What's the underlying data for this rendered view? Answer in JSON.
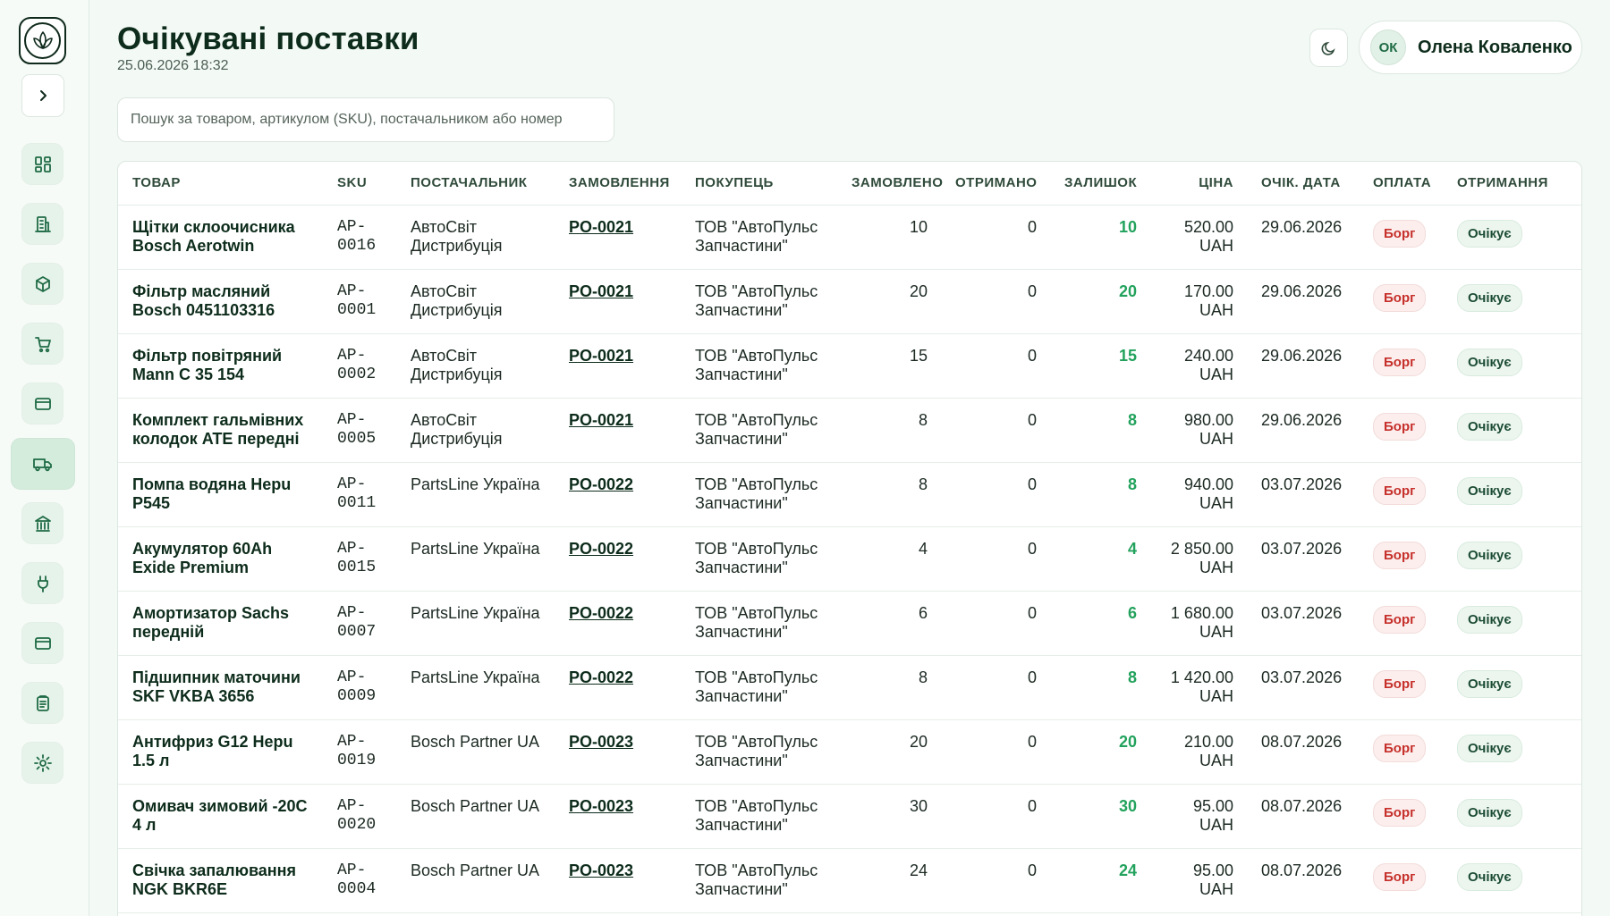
{
  "header": {
    "title": "Очікувані поставки",
    "timestamp": "25.06.2026 18:32"
  },
  "user": {
    "initials": "ОК",
    "name": "Олена Коваленко"
  },
  "search": {
    "placeholder": "Пошук за товаром, артикулом (SKU), постачальником або номер"
  },
  "sidebar": {
    "items": [
      {
        "icon": "dashboard-icon"
      },
      {
        "icon": "building-icon"
      },
      {
        "icon": "box-icon"
      },
      {
        "icon": "cart-icon"
      },
      {
        "icon": "card-icon"
      },
      {
        "icon": "truck-icon",
        "active": true
      },
      {
        "icon": "bank-icon"
      },
      {
        "icon": "plug-icon"
      },
      {
        "icon": "card-icon"
      },
      {
        "icon": "clipboard-icon"
      },
      {
        "icon": "gear-icon"
      }
    ]
  },
  "table": {
    "columns": [
      "ТОВАР",
      "SKU",
      "ПОСТАЧАЛЬНИК",
      "ЗАМОВЛЕННЯ",
      "ПОКУПЕЦЬ",
      "ЗАМОВЛЕНО",
      "ОТРИМАНО",
      "ЗАЛИШОК",
      "ЦІНА",
      "ОЧІК. ДАТА",
      "ОПЛАТА",
      "ОТРИМАННЯ"
    ],
    "rows": [
      {
        "product": "Щітки склоочисника Bosch Aerotwin",
        "sku": "AP-0016",
        "supplier": "АвтоСвіт Дистрибуція",
        "order": "PO-0021",
        "buyer": "ТОВ \"АвтоПульс Запчастини\"",
        "ordered": "10",
        "received": "0",
        "remaining": "10",
        "price": "520.00 UAH",
        "date": "29.06.2026",
        "payment": "Борг",
        "status": "Очікує"
      },
      {
        "product": "Фільтр масляний Bosch 0451103316",
        "sku": "AP-0001",
        "supplier": "АвтоСвіт Дистрибуція",
        "order": "PO-0021",
        "buyer": "ТОВ \"АвтоПульс Запчастини\"",
        "ordered": "20",
        "received": "0",
        "remaining": "20",
        "price": "170.00 UAH",
        "date": "29.06.2026",
        "payment": "Борг",
        "status": "Очікує"
      },
      {
        "product": "Фільтр повітряний Mann C 35 154",
        "sku": "AP-0002",
        "supplier": "АвтоСвіт Дистрибуція",
        "order": "PO-0021",
        "buyer": "ТОВ \"АвтоПульс Запчастини\"",
        "ordered": "15",
        "received": "0",
        "remaining": "15",
        "price": "240.00 UAH",
        "date": "29.06.2026",
        "payment": "Борг",
        "status": "Очікує"
      },
      {
        "product": "Комплект гальмівних колодок ATE передні",
        "sku": "AP-0005",
        "supplier": "АвтоСвіт Дистрибуція",
        "order": "PO-0021",
        "buyer": "ТОВ \"АвтоПульс Запчастини\"",
        "ordered": "8",
        "received": "0",
        "remaining": "8",
        "price": "980.00 UAH",
        "date": "29.06.2026",
        "payment": "Борг",
        "status": "Очікує"
      },
      {
        "product": "Помпа водяна Hepu P545",
        "sku": "AP-0011",
        "supplier": "PartsLine Україна",
        "order": "PO-0022",
        "buyer": "ТОВ \"АвтоПульс Запчастини\"",
        "ordered": "8",
        "received": "0",
        "remaining": "8",
        "price": "940.00 UAH",
        "date": "03.07.2026",
        "payment": "Борг",
        "status": "Очікує"
      },
      {
        "product": "Акумулятор 60Ah Exide Premium",
        "sku": "AP-0015",
        "supplier": "PartsLine Україна",
        "order": "PO-0022",
        "buyer": "ТОВ \"АвтоПульс Запчастини\"",
        "ordered": "4",
        "received": "0",
        "remaining": "4",
        "price": "2 850.00 UAH",
        "date": "03.07.2026",
        "payment": "Борг",
        "status": "Очікує"
      },
      {
        "product": "Амортизатор Sachs передній",
        "sku": "AP-0007",
        "supplier": "PartsLine Україна",
        "order": "PO-0022",
        "buyer": "ТОВ \"АвтоПульс Запчастини\"",
        "ordered": "6",
        "received": "0",
        "remaining": "6",
        "price": "1 680.00 UAH",
        "date": "03.07.2026",
        "payment": "Борг",
        "status": "Очікує"
      },
      {
        "product": "Підшипник маточини SKF VKBA 3656",
        "sku": "AP-0009",
        "supplier": "PartsLine Україна",
        "order": "PO-0022",
        "buyer": "ТОВ \"АвтоПульс Запчастини\"",
        "ordered": "8",
        "received": "0",
        "remaining": "8",
        "price": "1 420.00 UAH",
        "date": "03.07.2026",
        "payment": "Борг",
        "status": "Очікує"
      },
      {
        "product": "Антифриз G12 Hepu 1.5 л",
        "sku": "AP-0019",
        "supplier": "Bosch Partner UA",
        "order": "PO-0023",
        "buyer": "ТОВ \"АвтоПульс Запчастини\"",
        "ordered": "20",
        "received": "0",
        "remaining": "20",
        "price": "210.00 UAH",
        "date": "08.07.2026",
        "payment": "Борг",
        "status": "Очікує"
      },
      {
        "product": "Омивач зимовий -20C 4 л",
        "sku": "AP-0020",
        "supplier": "Bosch Partner UA",
        "order": "PO-0023",
        "buyer": "ТОВ \"АвтоПульс Запчастини\"",
        "ordered": "30",
        "received": "0",
        "remaining": "30",
        "price": "95.00 UAH",
        "date": "08.07.2026",
        "payment": "Борг",
        "status": "Очікує"
      },
      {
        "product": "Свічка запалювання NGK BKR6E",
        "sku": "AP-0004",
        "supplier": "Bosch Partner UA",
        "order": "PO-0023",
        "buyer": "ТОВ \"АвтоПульс Запчастини\"",
        "ordered": "24",
        "received": "0",
        "remaining": "24",
        "price": "95.00 UAH",
        "date": "08.07.2026",
        "payment": "Борг",
        "status": "Очікує"
      }
    ]
  },
  "colors": {
    "accent": "#1f6b45",
    "remaining": "#22a25c",
    "debt": "#c62f2a"
  }
}
